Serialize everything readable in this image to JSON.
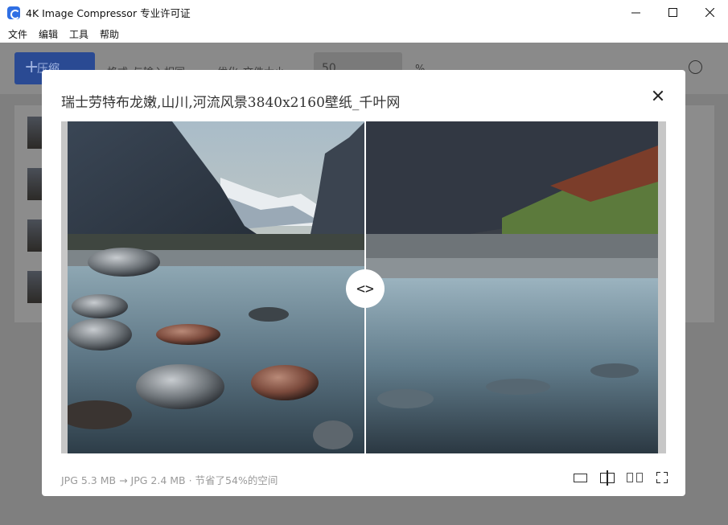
{
  "window": {
    "title": "4K Image Compressor 专业许可证",
    "minimize": "—",
    "maximize": "☐",
    "close": "✕"
  },
  "menu": [
    "文件",
    "编辑",
    "工具",
    "帮助"
  ],
  "toolbar": {
    "add_label": "压缩",
    "format_label": "格式",
    "format_value": "与输入相同",
    "optimize_label": "优化",
    "optimize_value": "文件大小",
    "quality_value": "50",
    "quality_unit": "%"
  },
  "modal": {
    "title": "瑞士劳特布龙嫩,山川,河流风景3840x2160壁纸_千叶网",
    "info": "JPG 5.3 MB → JPG 2.4 MB · 节省了54%的空间",
    "handle_glyph": "<>"
  },
  "colors": {
    "accent": "#2f6fe4",
    "overlay": "#7f7f7f"
  }
}
